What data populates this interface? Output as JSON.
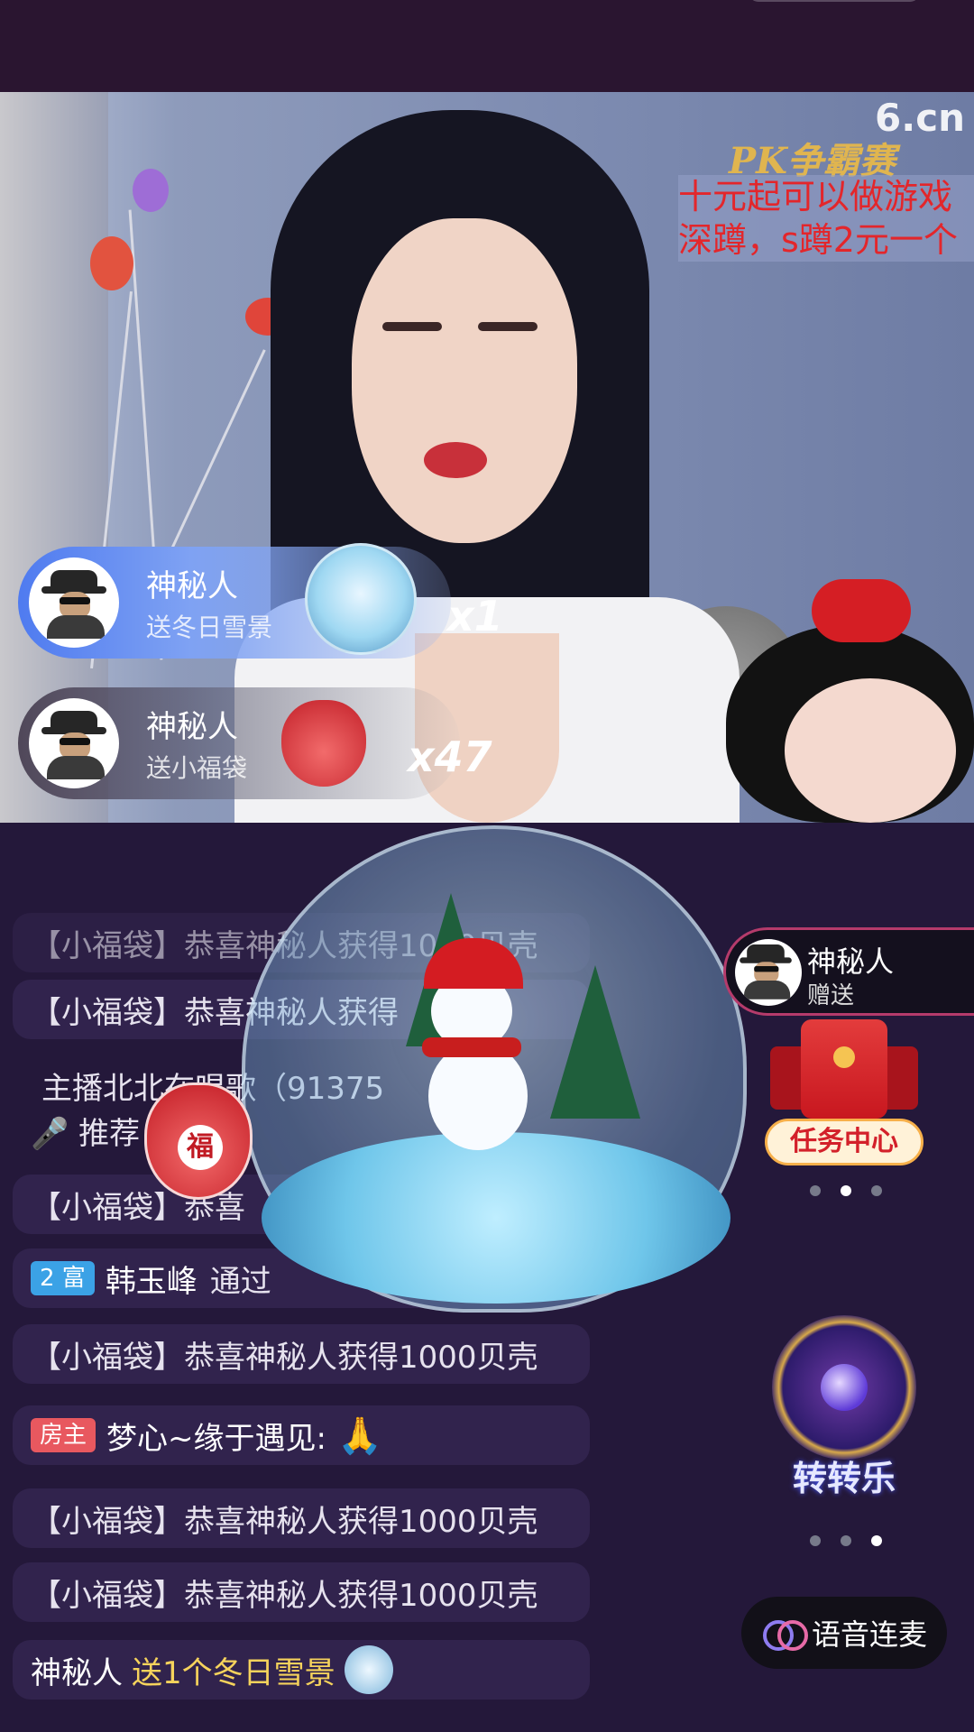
{
  "video": {
    "site_logo": "6.cn",
    "pk_title": "PK争霸赛",
    "notice_lines": [
      "十元起可以做游戏",
      "深蹲，s蹲2元一个"
    ]
  },
  "gift_notifications": [
    {
      "user": "神秘人",
      "action": "送冬日雪景",
      "count": "x1"
    },
    {
      "user": "神秘人",
      "action": "送小福袋",
      "count": "x47"
    }
  ],
  "chat": {
    "msg_partial_top": "【小福袋】恭喜神秘人获得1000贝壳",
    "msg_1": "【小福袋】恭喜神秘人获得",
    "system_line1": "主播北北在唱歌（91375",
    "system_line2": "推荐",
    "msg_3": "【小福袋】恭喜",
    "msg_4_badge": "2 富",
    "msg_4_user": "韩玉峰",
    "msg_4_text": "通过",
    "msg_5": "【小福袋】恭喜神秘人获得1000贝壳",
    "msg_6_badge": "房主",
    "msg_6_user": "梦心~缘于遇见:",
    "msg_7": "【小福袋】恭喜神秘人获得1000贝壳",
    "msg_8": "【小福袋】恭喜神秘人获得1000贝壳",
    "msg_9_user": "神秘人",
    "msg_9_text": "送1个冬日雪景"
  },
  "floating_bag": {
    "char": "福"
  },
  "right_panel": {
    "gift_notice_user": "神秘人",
    "gift_notice_action": "赠送",
    "task_center_label": "任务中心",
    "zhuanzhuanle_label": "转转乐",
    "voice_button_label": "语音连麦"
  },
  "colors": {
    "background": "#24183a",
    "highlight_yellow": "#f6d35c",
    "task_red": "#d3202a"
  }
}
